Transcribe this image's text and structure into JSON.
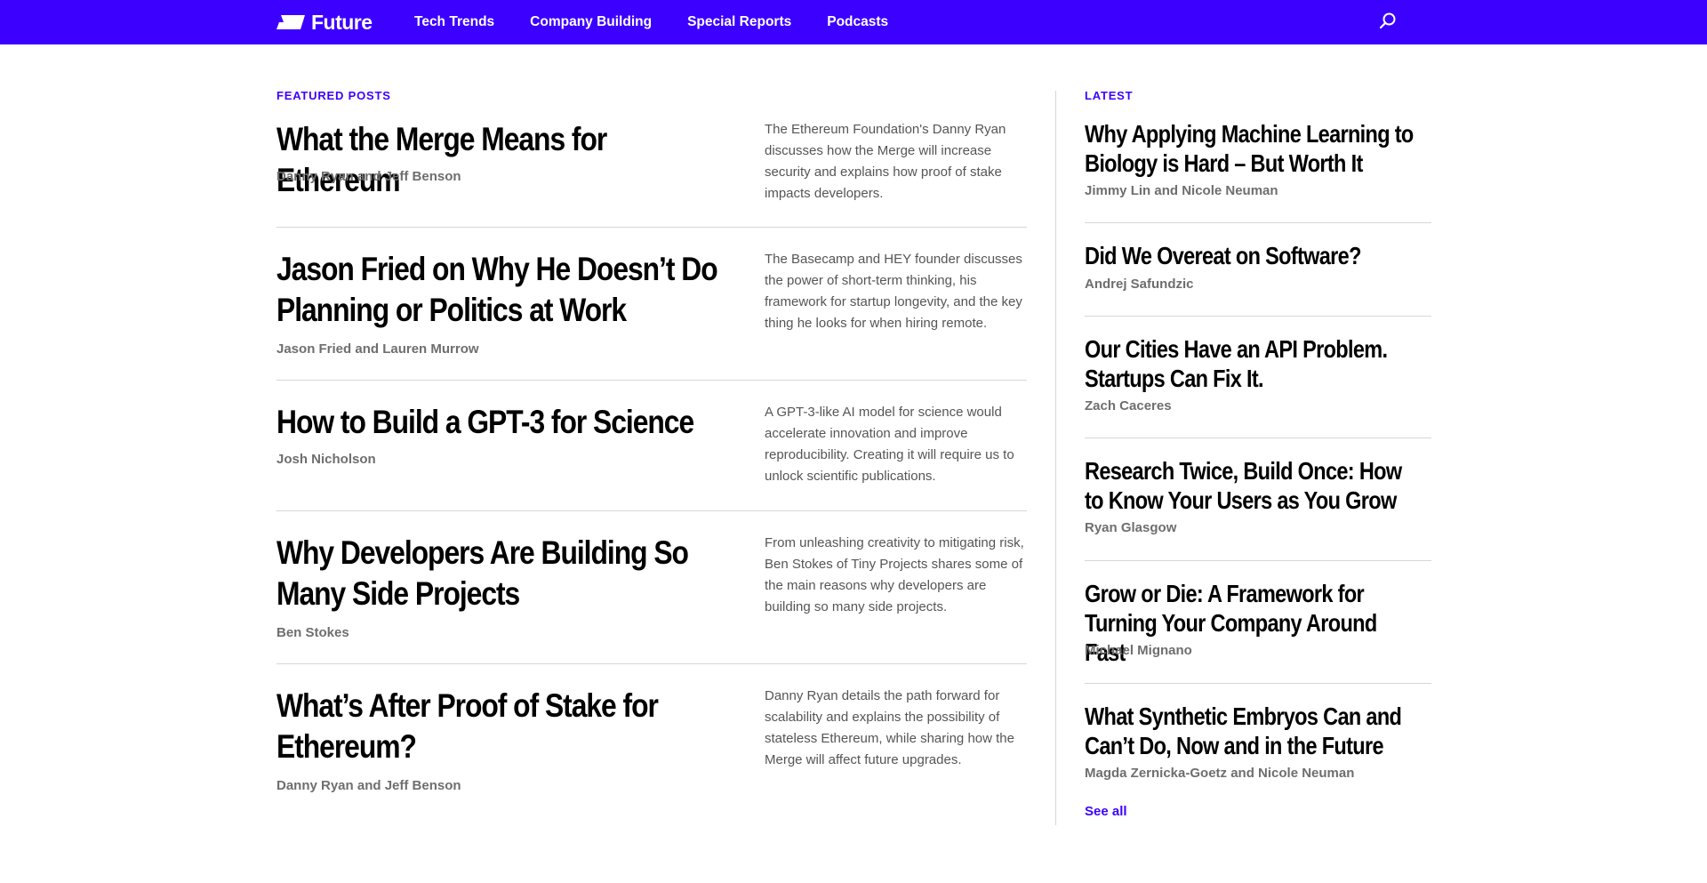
{
  "brand": {
    "name": "Future",
    "accent": "#3b00ff"
  },
  "nav": {
    "items": [
      "Tech Trends",
      "Company Building",
      "Special Reports",
      "Podcasts"
    ],
    "search_icon": "search-icon"
  },
  "featured": {
    "label": "FEATURED POSTS",
    "posts": [
      {
        "title": "What the Merge Means for Ethereum",
        "author": "Danny Ryan and Jeff Benson",
        "description": "The Ethereum Foundation's Danny Ryan discusses how the Merge will increase security and explains how proof of stake impacts developers."
      },
      {
        "title": "Jason Fried on Why He Doesn’t Do Planning or Politics at Work",
        "author": "Jason Fried and Lauren Murrow",
        "description": "The Basecamp and HEY founder discusses the power of short-term thinking, his framework for startup longevity, and the key thing he looks for when hiring remote."
      },
      {
        "title": "How to Build a GPT-3 for Science",
        "author": "Josh Nicholson",
        "description": "A GPT-3-like AI model for science would accelerate innovation and improve reproducibility. Creating it will require us to unlock scientific publications."
      },
      {
        "title": "Why Developers Are Building So Many Side Projects",
        "author": "Ben Stokes",
        "description": "From unleashing creativity to mitigating risk, Ben Stokes of Tiny Projects shares some of the main reasons why developers are building so many side projects."
      },
      {
        "title": "What’s After Proof of Stake for Ethereum?",
        "author": "Danny Ryan and Jeff Benson",
        "description": "Danny Ryan details the path forward for scalability and explains the possibility of stateless Ethereum, while sharing how the Merge will affect future upgrades."
      }
    ]
  },
  "latest": {
    "label": "LATEST",
    "posts": [
      {
        "title": "Why Applying Machine Learning to Biology is Hard – But Worth It",
        "author": "Jimmy Lin and Nicole Neuman"
      },
      {
        "title": "Did We Overeat on Software?",
        "author": "Andrej Safundzic"
      },
      {
        "title": "Our Cities Have an API Problem. Startups Can Fix It.",
        "author": "Zach Caceres"
      },
      {
        "title": "Research Twice, Build Once: How to Know Your Users as You Grow",
        "author": "Ryan Glasgow"
      },
      {
        "title": "Grow or Die: A Framework for Turning Your Company Around Fast",
        "author": "Michael Mignano"
      },
      {
        "title": "What Synthetic Embryos Can and Can’t Do, Now and in the Future",
        "author": "Magda Zernicka-Goetz and Nicole Neuman"
      }
    ],
    "see_all": "See all"
  }
}
